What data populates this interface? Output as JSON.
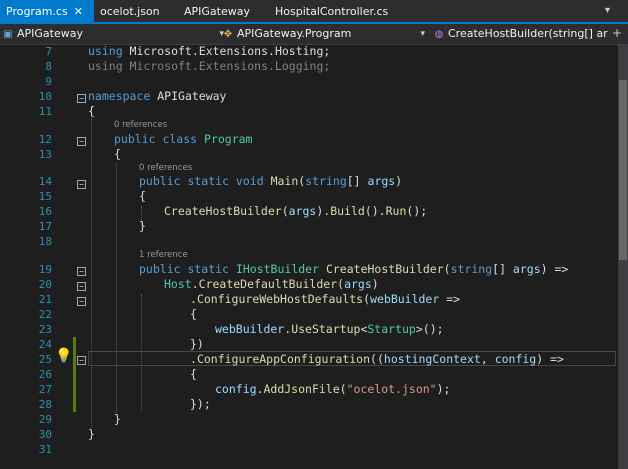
{
  "tabs": [
    {
      "label": "Program.cs",
      "close": "✕",
      "active": true
    },
    {
      "label": "ocelot.json",
      "active": false
    },
    {
      "label": "APIGateway",
      "active": false
    },
    {
      "label": "HospitalController.cs",
      "active": false
    }
  ],
  "navbar": {
    "project": "APIGateway",
    "type": "APIGateway.Program",
    "member": "CreateHostBuilder(string[] args)"
  },
  "codelens": {
    "ref0_class": "0 references",
    "ref0_main": "0 references",
    "ref1_builder": "1 reference"
  },
  "lines": [
    {
      "n": "7",
      "parts": [
        {
          "c": "kw",
          "t": "using "
        },
        {
          "c": "tx",
          "t": "Microsoft.Extensions.Hosting;"
        }
      ]
    },
    {
      "n": "8",
      "parts": [
        {
          "c": "dim",
          "t": "using Microsoft.Extensions.Logging;"
        }
      ]
    },
    {
      "n": "9",
      "parts": []
    },
    {
      "n": "10",
      "parts": [
        {
          "c": "kw",
          "t": "namespace "
        },
        {
          "c": "tx",
          "t": "APIGateway"
        }
      ]
    },
    {
      "n": "11",
      "parts": [
        {
          "c": "tx",
          "t": "{"
        }
      ]
    },
    {
      "n": "12",
      "parts": [
        {
          "c": "kw",
          "t": "public class "
        },
        {
          "c": "ty",
          "t": "Program"
        }
      ]
    },
    {
      "n": "13",
      "parts": [
        {
          "c": "tx",
          "t": "{"
        }
      ]
    },
    {
      "n": "14",
      "parts": [
        {
          "c": "kw",
          "t": "public static void "
        },
        {
          "c": "fn",
          "t": "Main"
        },
        {
          "c": "tx",
          "t": "("
        },
        {
          "c": "kw",
          "t": "string"
        },
        {
          "c": "tx",
          "t": "[] "
        },
        {
          "c": "pa",
          "t": "args"
        },
        {
          "c": "tx",
          "t": ")"
        }
      ]
    },
    {
      "n": "15",
      "parts": [
        {
          "c": "tx",
          "t": "{"
        }
      ]
    },
    {
      "n": "16",
      "parts": [
        {
          "c": "fn",
          "t": "CreateHostBuilder"
        },
        {
          "c": "tx",
          "t": "("
        },
        {
          "c": "pa",
          "t": "args"
        },
        {
          "c": "tx",
          "t": ")."
        },
        {
          "c": "fn",
          "t": "Build"
        },
        {
          "c": "tx",
          "t": "()."
        },
        {
          "c": "fn",
          "t": "Run"
        },
        {
          "c": "tx",
          "t": "();"
        }
      ]
    },
    {
      "n": "17",
      "parts": [
        {
          "c": "tx",
          "t": "}"
        }
      ]
    },
    {
      "n": "18",
      "parts": []
    },
    {
      "n": "19",
      "parts": [
        {
          "c": "kw",
          "t": "public static "
        },
        {
          "c": "ty",
          "t": "IHostBuilder "
        },
        {
          "c": "fn",
          "t": "CreateHostBuilder"
        },
        {
          "c": "tx",
          "t": "("
        },
        {
          "c": "kw",
          "t": "string"
        },
        {
          "c": "tx",
          "t": "[] "
        },
        {
          "c": "pa",
          "t": "args"
        },
        {
          "c": "tx",
          "t": ") =>"
        }
      ]
    },
    {
      "n": "20",
      "parts": [
        {
          "c": "ty",
          "t": "Host"
        },
        {
          "c": "tx",
          "t": "."
        },
        {
          "c": "fn",
          "t": "CreateDefaultBuilder"
        },
        {
          "c": "tx",
          "t": "("
        },
        {
          "c": "pa",
          "t": "args"
        },
        {
          "c": "tx",
          "t": ")"
        }
      ]
    },
    {
      "n": "21",
      "parts": [
        {
          "c": "tx",
          "t": "."
        },
        {
          "c": "fn",
          "t": "ConfigureWebHostDefaults"
        },
        {
          "c": "tx",
          "t": "("
        },
        {
          "c": "pa",
          "t": "webBuilder"
        },
        {
          "c": "tx",
          "t": " =>"
        }
      ]
    },
    {
      "n": "22",
      "parts": [
        {
          "c": "tx",
          "t": "{"
        }
      ]
    },
    {
      "n": "23",
      "parts": [
        {
          "c": "pa",
          "t": "webBuilder"
        },
        {
          "c": "tx",
          "t": "."
        },
        {
          "c": "fn",
          "t": "UseStartup"
        },
        {
          "c": "tx",
          "t": "<"
        },
        {
          "c": "ty",
          "t": "Startup"
        },
        {
          "c": "tx",
          "t": ">();"
        }
      ]
    },
    {
      "n": "24",
      "parts": [
        {
          "c": "tx",
          "t": "})"
        }
      ]
    },
    {
      "n": "25",
      "parts": [
        {
          "c": "tx",
          "t": "."
        },
        {
          "c": "fn",
          "t": "ConfigureAppConfiguration"
        },
        {
          "c": "tx",
          "t": "(("
        },
        {
          "c": "pa",
          "t": "hostingContext"
        },
        {
          "c": "tx",
          "t": ", "
        },
        {
          "c": "pa",
          "t": "config"
        },
        {
          "c": "tx",
          "t": ") =>"
        }
      ]
    },
    {
      "n": "26",
      "parts": [
        {
          "c": "tx",
          "t": "{"
        }
      ]
    },
    {
      "n": "27",
      "parts": [
        {
          "c": "pa",
          "t": "config"
        },
        {
          "c": "tx",
          "t": "."
        },
        {
          "c": "fn",
          "t": "AddJsonFile"
        },
        {
          "c": "tx",
          "t": "("
        },
        {
          "c": "st",
          "t": "\"ocelot.json\""
        },
        {
          "c": "tx",
          "t": ");"
        }
      ]
    },
    {
      "n": "28",
      "parts": [
        {
          "c": "tx",
          "t": "});"
        }
      ]
    },
    {
      "n": "29",
      "parts": [
        {
          "c": "tx",
          "t": "}"
        }
      ]
    },
    {
      "n": "30",
      "parts": [
        {
          "c": "tx",
          "t": "}"
        }
      ]
    },
    {
      "n": "31",
      "parts": []
    }
  ]
}
